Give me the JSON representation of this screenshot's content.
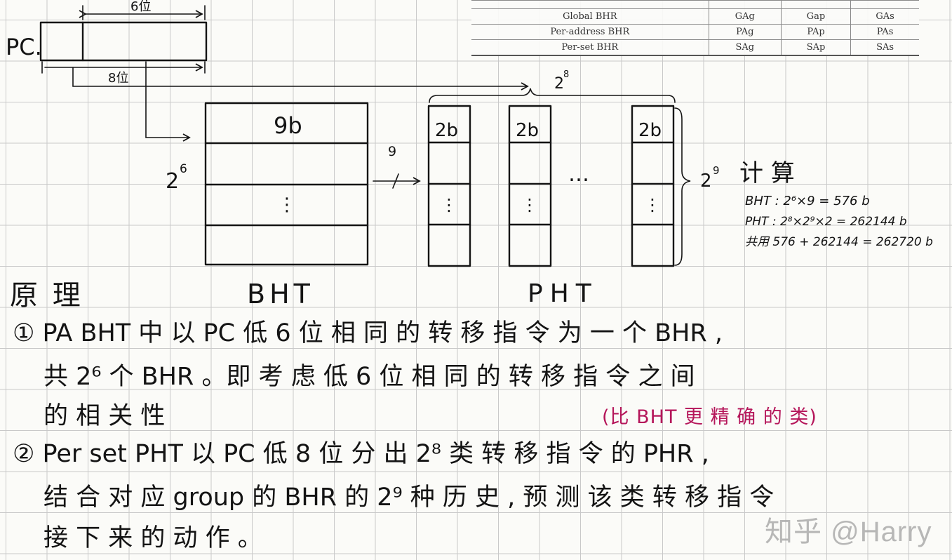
{
  "table": {
    "rows": [
      {
        "label": "Global BHR",
        "c1": "GAg",
        "c2": "Gap",
        "c3": "GAs"
      },
      {
        "label": "Per-address BHR",
        "c1": "PAg",
        "c2": "PAp",
        "c3": "PAs"
      },
      {
        "label": "Per-set BHR",
        "c1": "SAg",
        "c2": "SAp",
        "c3": "SAs"
      }
    ]
  },
  "diagram": {
    "pc_label": "PC.",
    "pc_top_width": "6位",
    "pc_bottom_width": "8位",
    "bht_rows": "2",
    "bht_rows_exp": "6",
    "bht_width": "9b",
    "bht_label": "BHT",
    "bus_width": "9",
    "pht_count": "2",
    "pht_count_exp": "8",
    "pht_entry": "2b",
    "pht_rows": "2",
    "pht_rows_exp": "9",
    "pht_label": "PHT",
    "ellipsis": "…",
    "vdots": "⋮"
  },
  "calc": {
    "title": "计 算",
    "line1": "BHT : 2⁶×9 = 576 b",
    "line2": "PHT : 2⁸×2⁹×2 = 262144 b",
    "line3": "共用 576 + 262144 = 262720 b"
  },
  "notes": {
    "heading": "原 理",
    "l1": "①  PA BHT 中 以 PC 低 6 位 相 同 的 转 移 指 令 为 一 个 BHR ,",
    "l2": "共 2⁶ 个 BHR 。即 考 虑 低 6 位 相 同 的 转 移 指 令 之 间",
    "l3": "的 相 关 性",
    "l3_annot": "(比 BHT 更 精 确 的 类)",
    "l4": "②  Per set PHT 以 PC 低 8 位 分 出 2⁸ 类 转 移 指 令 的 PHR ,",
    "l5": "结 合 对 应 group 的 BHR 的 2⁹ 种 历 史 , 预 测 该 类 转 移 指 令",
    "l6": "接 下 来 的 动 作 。"
  },
  "watermark": "知乎 @Harry",
  "colors": {
    "ink": "#141414",
    "annotation": "#b5165a",
    "grid": "#c9c9c9"
  }
}
